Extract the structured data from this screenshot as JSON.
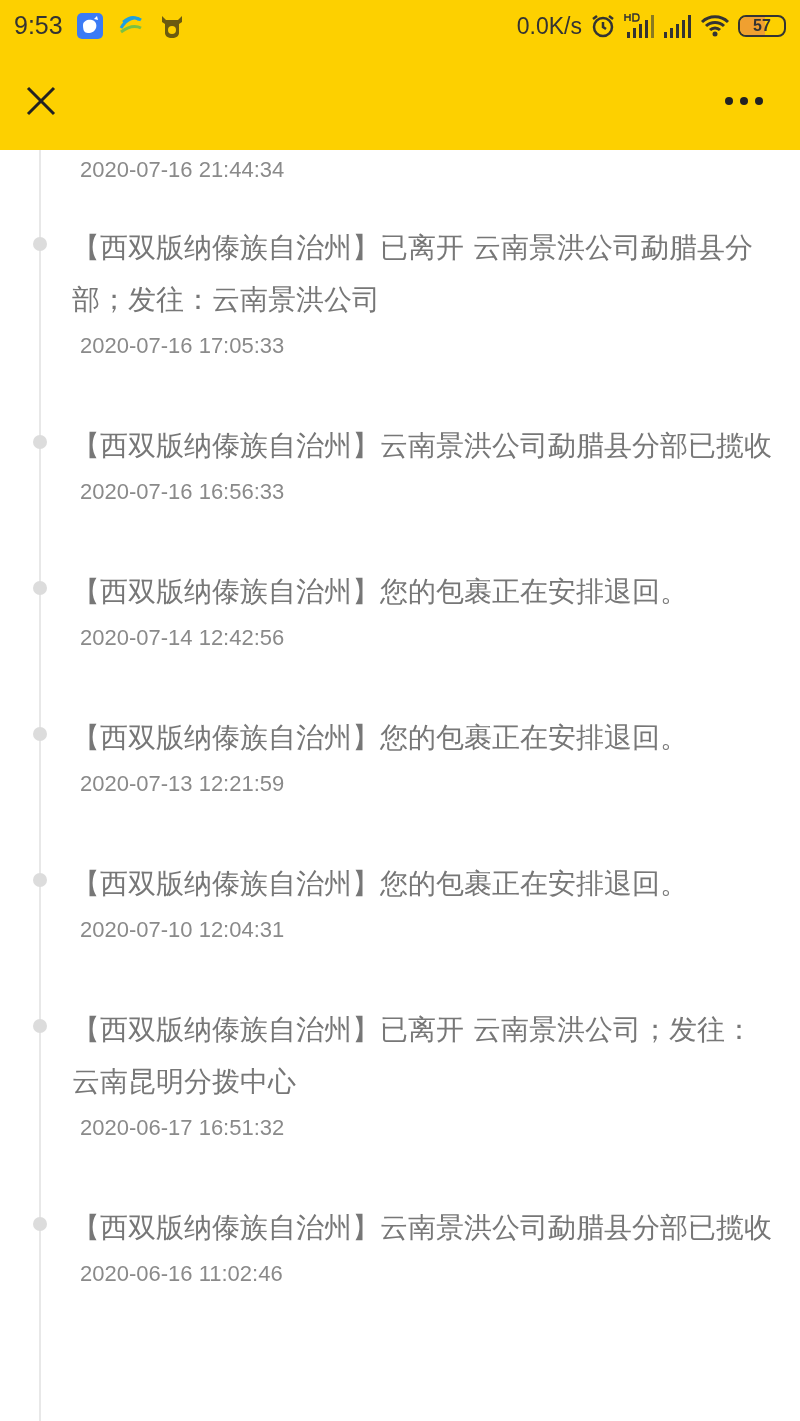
{
  "status_bar": {
    "time": "9:53",
    "network_speed": "0.0K/s",
    "battery": "57"
  },
  "tracking": {
    "first_time": "2020-07-16 21:44:34",
    "events": [
      {
        "text": "【西双版纳傣族自治州】已离开 云南景洪公司勐腊县分部；发往：云南景洪公司",
        "time": "2020-07-16 17:05:33"
      },
      {
        "text": "【西双版纳傣族自治州】云南景洪公司勐腊县分部已揽收",
        "time": "2020-07-16 16:56:33"
      },
      {
        "text": "【西双版纳傣族自治州】您的包裹正在安排退回。",
        "time": "2020-07-14 12:42:56"
      },
      {
        "text": "【西双版纳傣族自治州】您的包裹正在安排退回。",
        "time": "2020-07-13 12:21:59"
      },
      {
        "text": "【西双版纳傣族自治州】您的包裹正在安排退回。",
        "time": "2020-07-10 12:04:31"
      },
      {
        "text": "【西双版纳傣族自治州】已离开 云南景洪公司；发往：云南昆明分拨中心",
        "time": "2020-06-17 16:51:32"
      },
      {
        "text": "【西双版纳傣族自治州】云南景洪公司勐腊县分部已揽收",
        "time": "2020-06-16 11:02:46"
      }
    ]
  }
}
